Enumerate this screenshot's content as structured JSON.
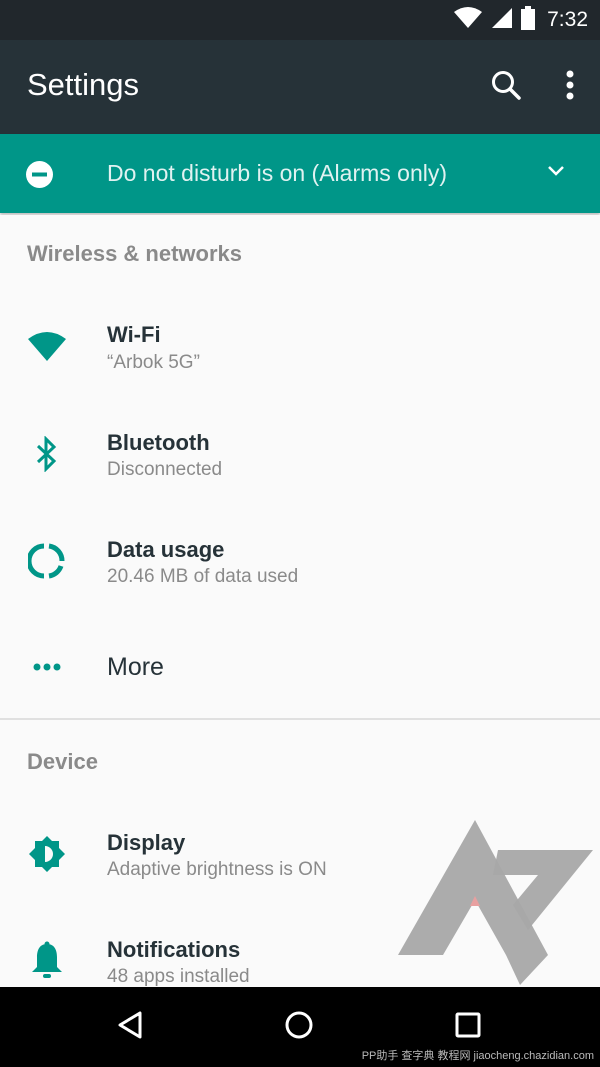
{
  "status_bar": {
    "time": "7:32",
    "icons": [
      "wifi-signal-icon",
      "cell-signal-icon",
      "battery-icon"
    ]
  },
  "toolbar": {
    "title": "Settings",
    "actions": [
      "search-icon",
      "overflow-menu-icon"
    ]
  },
  "dnd_banner": {
    "icon": "dnd-minus-icon",
    "text": "Do not disturb is on (Alarms only)",
    "expand_icon": "chevron-down-icon"
  },
  "sections": [
    {
      "header": "Wireless & networks",
      "items": [
        {
          "icon": "wifi-icon",
          "title": "Wi-Fi",
          "subtitle": "“Arbok 5G”"
        },
        {
          "icon": "bluetooth-icon",
          "title": "Bluetooth",
          "subtitle": "Disconnected"
        },
        {
          "icon": "data-usage-icon",
          "title": "Data usage",
          "subtitle": "20.46 MB of data used"
        },
        {
          "icon": "more-dots-icon",
          "title": "More",
          "subtitle": ""
        }
      ]
    },
    {
      "header": "Device",
      "items": [
        {
          "icon": "display-brightness-icon",
          "title": "Display",
          "subtitle": "Adaptive brightness is ON"
        },
        {
          "icon": "bell-icon",
          "title": "Notifications",
          "subtitle": "48 apps installed"
        }
      ]
    }
  ],
  "nav_bar": {
    "buttons": [
      "back-icon",
      "home-icon",
      "recents-icon"
    ]
  },
  "watermark": {
    "text": "PP助手 查字典 教程网 jiaocheng.chazidian.com"
  },
  "colors": {
    "accent": "#009688",
    "toolbar": "#263238",
    "status_bar": "#21272c"
  }
}
